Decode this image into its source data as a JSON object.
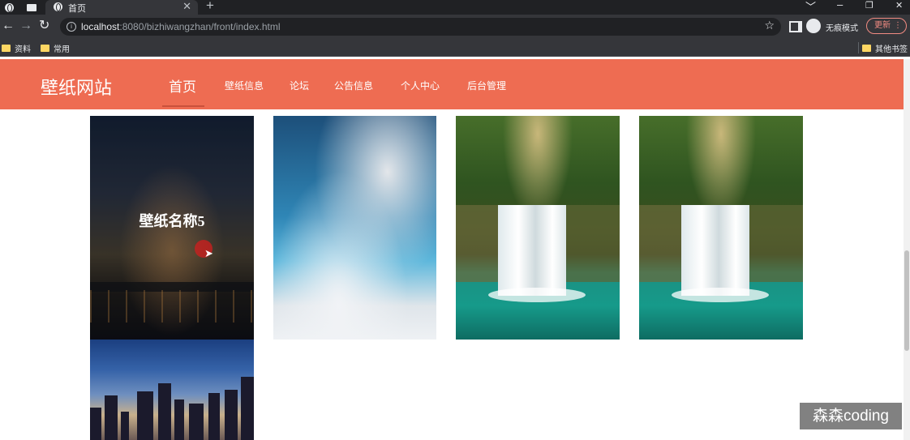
{
  "browser": {
    "tab_title": "首页",
    "tab_close": "✕",
    "new_tab": "+",
    "window_controls": [
      "﹀",
      "–",
      "❐",
      "✕"
    ],
    "url_host": "localhost",
    "url_rest": ":8080/bizhiwangzhan/front/index.html",
    "incognito_label": "无痕模式",
    "update_label": "更新",
    "menu_icon": "⋮",
    "nav": {
      "back": "←",
      "forward": "→",
      "reload": "↻",
      "star": "☆"
    },
    "bookmarks": [
      "资料",
      "常用"
    ],
    "other_bookmarks": "其他书签"
  },
  "site": {
    "logo": "壁纸网站",
    "nav": [
      "首页",
      "壁纸信息",
      "论坛",
      "公告信息",
      "个人中心",
      "后台管理"
    ],
    "accent_color": "#ee6c52"
  },
  "wallpapers": {
    "hover_title": "壁纸名称5"
  },
  "watermark": "森森coding"
}
